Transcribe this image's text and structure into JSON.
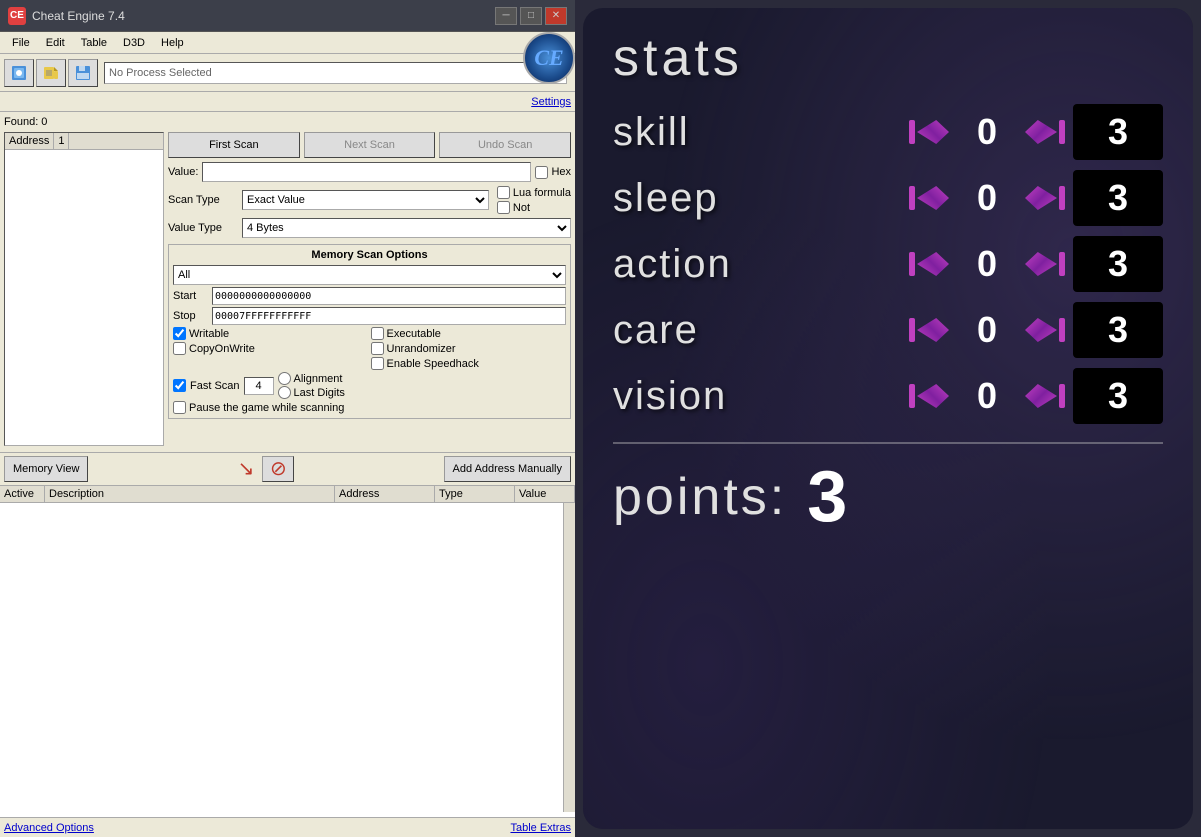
{
  "window": {
    "title": "Cheat Engine 7.4",
    "min_label": "─",
    "max_label": "□",
    "close_label": "✕"
  },
  "menu": {
    "items": [
      "File",
      "Edit",
      "Table",
      "D3D",
      "Help"
    ]
  },
  "toolbar": {
    "process_label": "No Process Selected"
  },
  "ce": {
    "found_label": "Found: 0",
    "address_col": "Address",
    "value_col": "1",
    "first_scan": "First Scan",
    "next_scan": "Next Scan",
    "undo_scan": "Undo Scan",
    "settings": "Settings",
    "value_label": "Value:",
    "hex_label": "Hex",
    "scan_type_label": "Scan Type",
    "scan_type_value": "Exact Value",
    "value_type_label": "Value Type",
    "value_type_value": "4 Bytes",
    "lua_formula": "Lua formula",
    "not_label": "Not",
    "memory_scan_title": "Memory Scan Options",
    "memory_all": "All",
    "start_label": "Start",
    "stop_label": "Stop",
    "start_value": "0000000000000000",
    "stop_value": "00007FFFFFFFFFFF",
    "writable_label": "Writable",
    "executable_label": "Executable",
    "copy_on_write": "CopyOnWrite",
    "unrandomizer": "Unrandomizer",
    "enable_speedhack": "Enable Speedhack",
    "fast_scan": "Fast Scan",
    "fast_scan_value": "4",
    "alignment": "Alignment",
    "last_digits": "Last Digits",
    "pause_game": "Pause the game while scanning",
    "memory_view": "Memory View",
    "add_address": "Add Address Manually",
    "table_active": "Active",
    "table_desc": "Description",
    "table_address": "Address",
    "table_type": "Type",
    "table_value": "Value",
    "advanced_options": "Advanced Options",
    "table_extras": "Table Extras"
  },
  "stats": {
    "title": "stats",
    "skill": "skill",
    "sleep": "sleep",
    "action": "action",
    "care": "care",
    "vision": "vision",
    "skill_val": "0",
    "sleep_val": "0",
    "action_val": "0",
    "care_val": "0",
    "vision_val": "0",
    "skill_box": "3",
    "sleep_box": "3",
    "action_box": "3",
    "care_box": "3",
    "vision_box": "3",
    "points_label": "points:",
    "points_value": "3"
  }
}
